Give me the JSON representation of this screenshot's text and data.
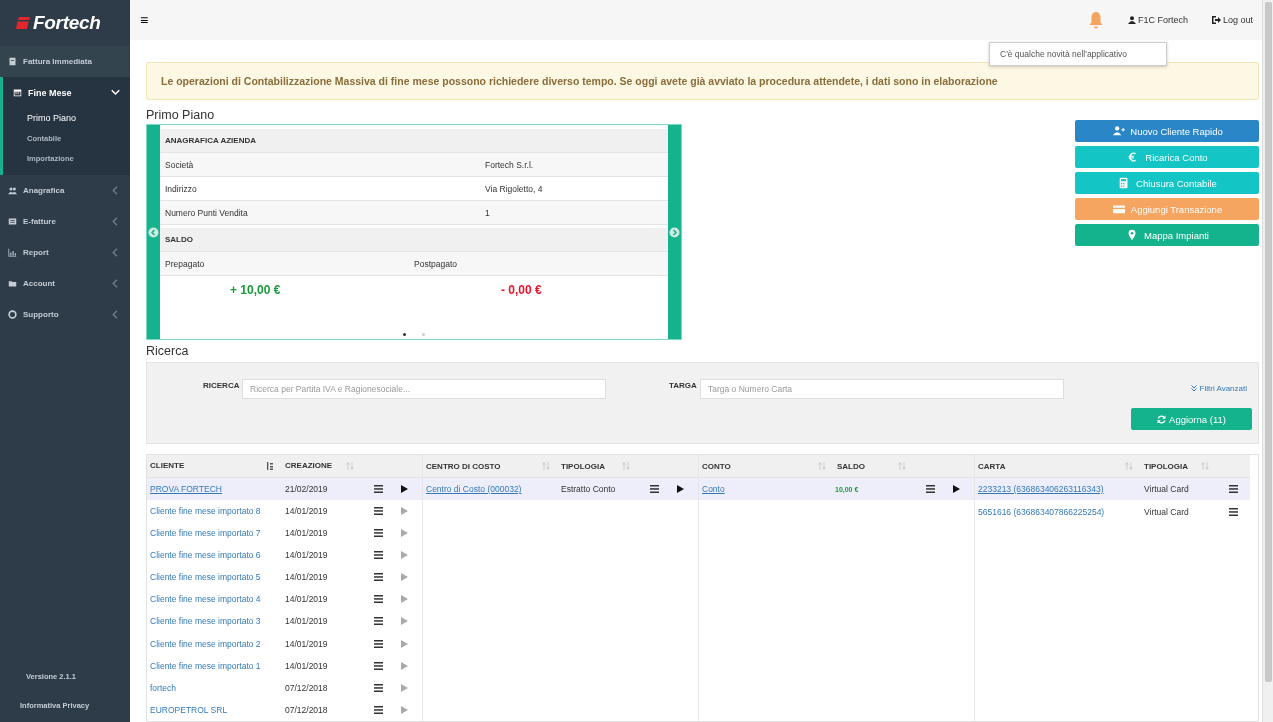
{
  "sidebar": {
    "logo": "Fortech",
    "items": [
      {
        "label": "Fattura Immediata",
        "expanded": false,
        "has_children": false
      },
      {
        "label": "Fine Mese",
        "expanded": true,
        "has_children": true,
        "children": [
          {
            "label": "Primo Piano",
            "selected": true
          },
          {
            "label": "Contabile",
            "selected": false
          },
          {
            "label": "Importazione",
            "selected": false
          }
        ]
      },
      {
        "label": "Anagrafica",
        "expanded": false,
        "has_children": true
      },
      {
        "label": "E-fatture",
        "expanded": false,
        "has_children": true
      },
      {
        "label": "Report",
        "expanded": false,
        "has_children": true
      },
      {
        "label": "Account",
        "expanded": false,
        "has_children": true
      },
      {
        "label": "Supporto",
        "expanded": false,
        "has_children": true
      }
    ],
    "version": "Versione 2.1.1",
    "privacy": "Informativa Privacy"
  },
  "topbar": {
    "menu": "≡",
    "user": "F1C Fortech",
    "logout": "Log out",
    "notification": "C'è qualche novità nell'applicativo"
  },
  "alert": "Le operazioni di Contabilizzazione Massiva di fine mese possono richiedere diverso tempo. Se oggi avete già avviato la procedura attendete, i dati sono in elaborazione",
  "primo_piano": {
    "title": "Primo Piano",
    "anagrafica": {
      "heading": "ANAGRAFICA AZIENDA",
      "rows": [
        {
          "label": "Società",
          "value": "Fortech S.r.l."
        },
        {
          "label": "Indirizzo",
          "value": "Via Rigoletto, 4"
        },
        {
          "label": "Numero Punti Vendita",
          "value": "1"
        }
      ]
    },
    "saldo": {
      "heading": "SALDO",
      "items": [
        {
          "label": "Prepagato",
          "amount": "+ 10,00 €",
          "kind": "positive"
        },
        {
          "label": "Postpagato",
          "amount": "- 0,00 €",
          "kind": "negative"
        }
      ]
    },
    "slides": [
      {
        "selected": true
      },
      {
        "selected": false
      }
    ]
  },
  "actions": [
    {
      "label": "Nuovo Cliente Rapido",
      "kind": "primary"
    },
    {
      "label": "Ricarica Conto",
      "kind": "info"
    },
    {
      "label": "Chiusura Contabile",
      "kind": "info"
    },
    {
      "label": "Aggiungi Transazione",
      "kind": "warning"
    },
    {
      "label": "Mappa Impianti",
      "kind": "success"
    }
  ],
  "ricerca": {
    "title": "Ricerca",
    "search_label": "RICERCA",
    "search_placeholder": "Ricerca per Partita IVA e Ragionesociale...",
    "targa_label": "TARGA",
    "targa_placeholder": "Targa o Numero Carta",
    "filters": "Filtri Avanzati",
    "refresh": "Aggiorna (11)"
  },
  "table": {
    "groups": [
      {
        "kind": "expandable",
        "columns": [
          {
            "label": "CLIENTE",
            "kind": "link",
            "sorted": true
          },
          {
            "label": "CREAZIONE",
            "kind": "text",
            "sorted": false
          }
        ],
        "rows": [
          {
            "cells": [
              "PROVA FORTECH",
              "21/02/2019"
            ],
            "selected": true
          },
          {
            "cells": [
              "Cliente fine mese importato 8",
              "14/01/2019"
            ],
            "selected": false
          },
          {
            "cells": [
              "Cliente fine mese importato 7",
              "14/01/2019"
            ],
            "selected": false
          },
          {
            "cells": [
              "Cliente fine mese importato 6",
              "14/01/2019"
            ],
            "selected": false
          },
          {
            "cells": [
              "Cliente fine mese importato 5",
              "14/01/2019"
            ],
            "selected": false
          },
          {
            "cells": [
              "Cliente fine mese importato 4",
              "14/01/2019"
            ],
            "selected": false
          },
          {
            "cells": [
              "Cliente fine mese importato 3",
              "14/01/2019"
            ],
            "selected": false
          },
          {
            "cells": [
              "Cliente fine mese importato 2",
              "14/01/2019"
            ],
            "selected": false
          },
          {
            "cells": [
              "Cliente fine mese importato 1",
              "14/01/2019"
            ],
            "selected": false
          },
          {
            "cells": [
              "fortech",
              "07/12/2018"
            ],
            "selected": false
          },
          {
            "cells": [
              "EUROPETROL SRL",
              "07/12/2018"
            ],
            "selected": false
          }
        ]
      },
      {
        "kind": "expandable",
        "columns": [
          {
            "label": "CENTRO DI COSTO",
            "kind": "link",
            "sorted": false
          },
          {
            "label": "TIPOLOGIA",
            "kind": "text",
            "sorted": false
          }
        ],
        "rows": [
          {
            "cells": [
              "Centro di Costo (000032)",
              "Estratto Conto"
            ],
            "selected": true
          }
        ]
      },
      {
        "kind": "expandable",
        "columns": [
          {
            "label": "CONTO",
            "kind": "link",
            "sorted": false
          },
          {
            "label": "SALDO",
            "kind": "amount",
            "sorted": false
          }
        ],
        "rows": [
          {
            "cells": [
              "Conto",
              "10,00 €"
            ],
            "selected": true
          }
        ]
      },
      {
        "kind": "leaf",
        "columns": [
          {
            "label": "CARTA",
            "kind": "link",
            "sorted": false
          },
          {
            "label": "TIPOLOGIA",
            "kind": "text",
            "sorted": false
          }
        ],
        "rows": [
          {
            "cells": [
              "2233213 (636863406263116343)",
              "Virtual Card"
            ],
            "selected": true
          },
          {
            "cells": [
              "5651616 (636863407866225254)",
              "Virtual Card"
            ],
            "selected": false
          }
        ]
      }
    ]
  }
}
